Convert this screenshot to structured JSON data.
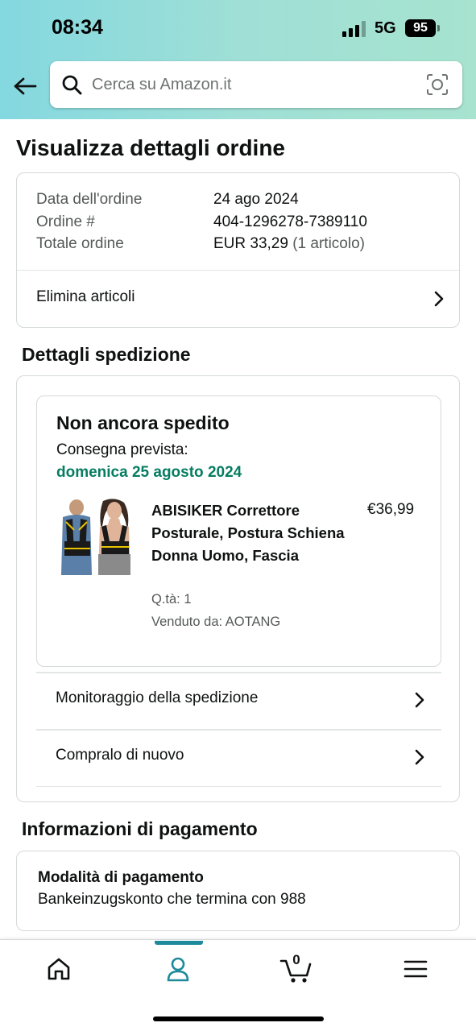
{
  "status": {
    "time": "08:34",
    "network": "5G",
    "battery": "95"
  },
  "search": {
    "placeholder": "Cerca su Amazon.it"
  },
  "page": {
    "title": "Visualizza dettagli ordine"
  },
  "order": {
    "date_label": "Data dell'ordine",
    "date_value": "24 ago 2024",
    "number_label": "Ordine #",
    "number_value": "404-1296278-7389110",
    "total_label": "Totale ordine",
    "total_value": "EUR 33,29",
    "total_items": "(1 articolo)",
    "remove_items": "Elimina articoli"
  },
  "shipping": {
    "section_title": "Dettagli spedizione",
    "status": "Non ancora spedito",
    "eta_label": "Consegna prevista:",
    "eta_date": "domenica 25 agosto 2024",
    "product": {
      "title": "ABISIKER Correttore Posturale, Postura Schiena Donna Uomo, Fascia",
      "price": "€36,99",
      "qty": "Q.tà: 1",
      "seller": "Venduto da: AOTANG"
    },
    "track_label": "Monitoraggio della spedizione",
    "buy_again_label": "Compralo di nuovo"
  },
  "payment": {
    "section_title": "Informazioni di pagamento",
    "method_title": "Modalità di pagamento",
    "method_value": "Bankeinzugskonto che termina con 988"
  },
  "nav": {
    "cart_count": "0",
    "active": "account",
    "accent_color": "#1f8a9b"
  },
  "colors": {
    "delivery_green": "#067d62",
    "header_gradient_start": "#84d8e0",
    "header_gradient_end": "#a7e3cf"
  }
}
